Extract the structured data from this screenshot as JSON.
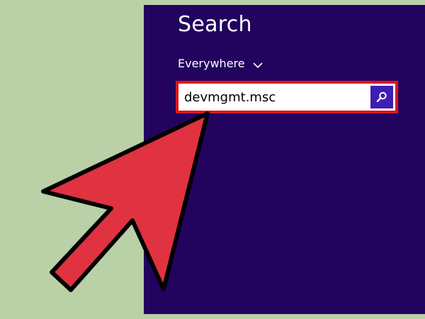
{
  "search_pane": {
    "title": "Search",
    "scope": {
      "label": "Everywhere",
      "icon": "chevron-down-icon"
    },
    "input": {
      "value": "devmgmt.msc",
      "placeholder": ""
    },
    "search_button": {
      "icon": "magnifier-icon"
    }
  },
  "colors": {
    "background": "#bad0a6",
    "pane": "#22045f",
    "highlight_border": "#e0141f",
    "search_button": "#3f1fb3",
    "arrow_fill": "#e03240",
    "arrow_outline": "#000000"
  },
  "annotation": {
    "icon": "pointer-arrow-icon"
  }
}
